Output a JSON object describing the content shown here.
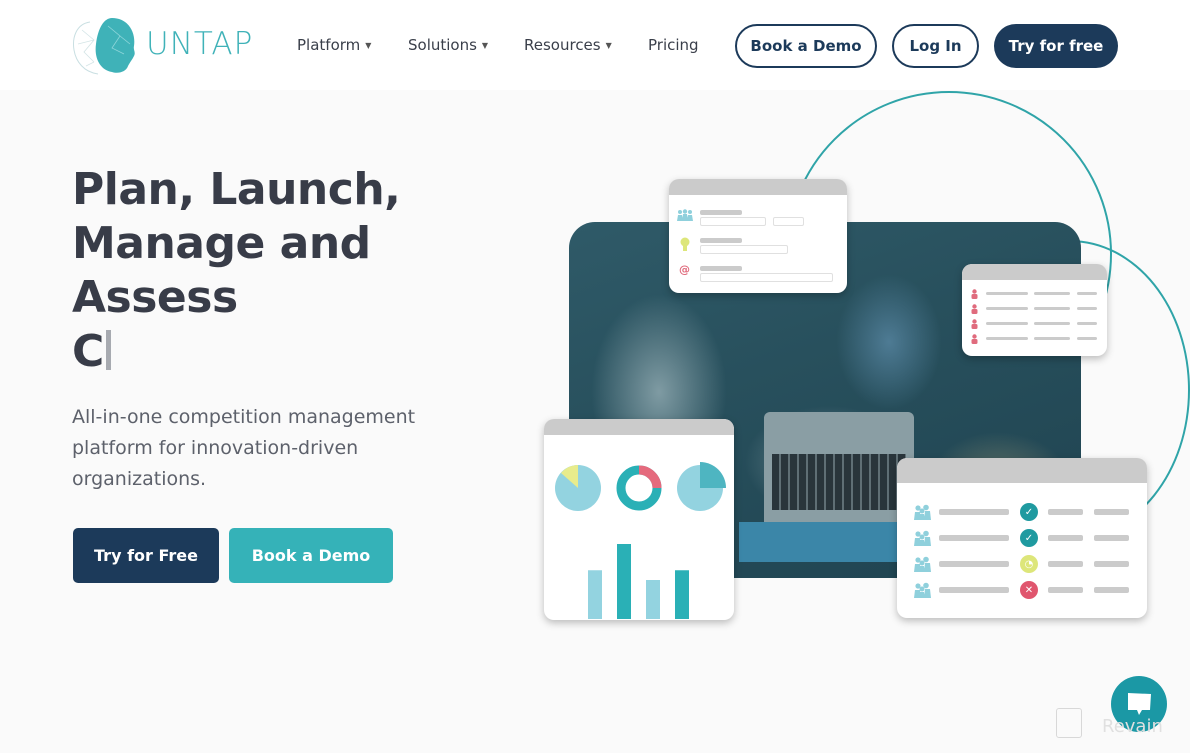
{
  "header": {
    "logo_text": "UNTAP",
    "nav": [
      {
        "label": "Platform",
        "has_dropdown": true
      },
      {
        "label": "Solutions",
        "has_dropdown": true
      },
      {
        "label": "Resources",
        "has_dropdown": true
      },
      {
        "label": "Pricing",
        "has_dropdown": false
      }
    ],
    "caret": "▼",
    "book_demo": "Book a Demo",
    "log_in": "Log In",
    "try_free": "Try for free"
  },
  "hero": {
    "title_lines": [
      "Plan, Launch,",
      "Manage and",
      "Assess",
      "C"
    ],
    "subtitle": "All-in-one competition management platform for innovation-driven organizations.",
    "primary_cta": "Try for Free",
    "secondary_cta": "Book a Demo"
  },
  "illustration": {
    "form_card_icons": [
      "team-icon",
      "lightbulb-icon",
      "at-sign-icon"
    ],
    "users_card_rows": 4,
    "chart_card": {
      "pies": [
        "pie-small-yellow-slice",
        "donut-red-segment",
        "pie-quarter-slice"
      ],
      "bars": [
        0.65,
        1.0,
        0.52,
        0.65
      ]
    },
    "status_card_rows": [
      {
        "status": "approved"
      },
      {
        "status": "approved"
      },
      {
        "status": "pending"
      },
      {
        "status": "rejected"
      }
    ]
  },
  "watermark": "Revain",
  "colors": {
    "brand_teal": "#3fb2b8",
    "navy": "#1c3a5a",
    "cta_teal": "#35b2b8",
    "approved": "#1f9aa0",
    "pending": "#dde67a",
    "rejected": "#e0566e",
    "user_red": "#e06b7d"
  }
}
